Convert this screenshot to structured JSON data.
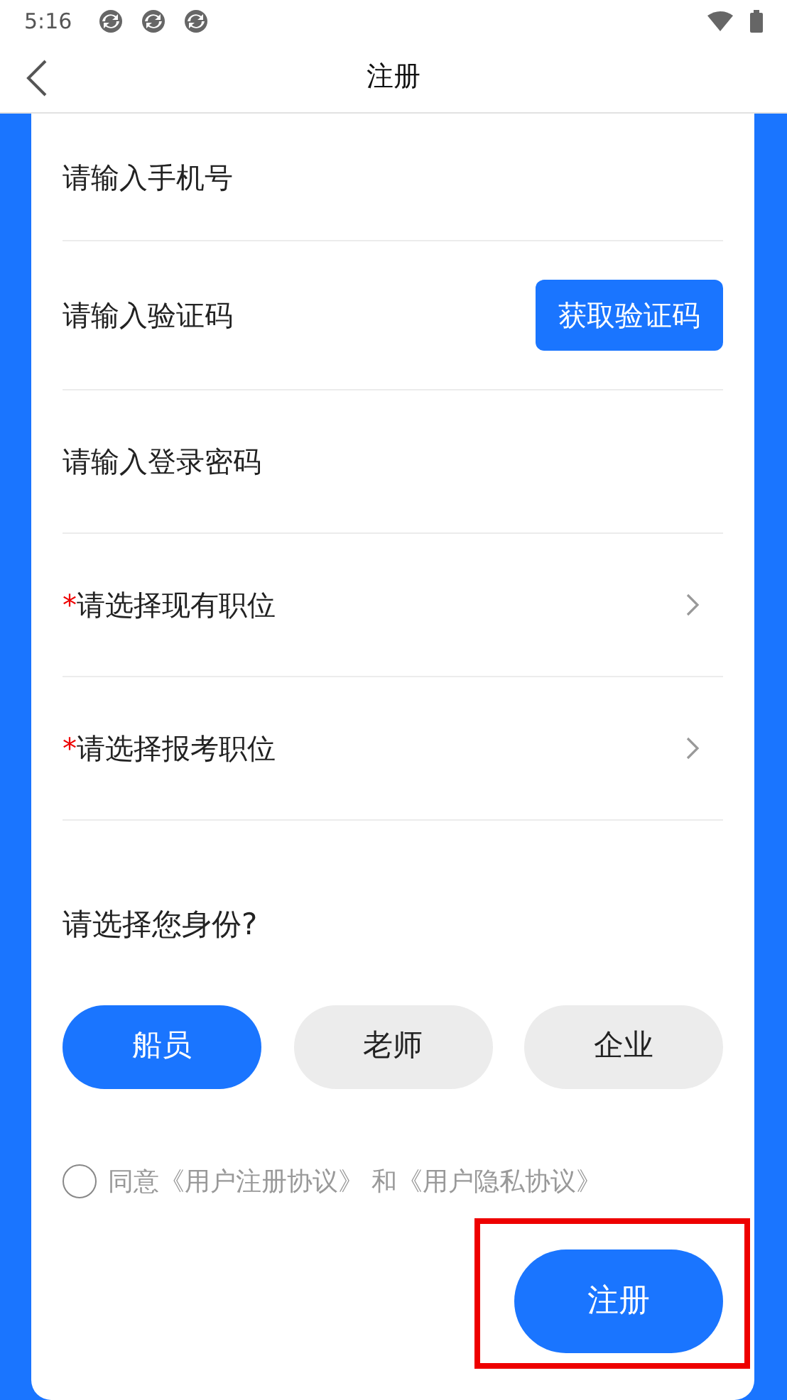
{
  "status_bar": {
    "time": "5:16"
  },
  "header": {
    "title": "注册"
  },
  "fields": [
    {
      "kind": "input",
      "placeholder": "请输入手机号"
    },
    {
      "kind": "code",
      "placeholder": "请输入验证码",
      "button": "获取验证码"
    },
    {
      "kind": "input",
      "placeholder": "请输入登录密码"
    },
    {
      "kind": "select",
      "marker": "*",
      "label": "请选择现有职位"
    },
    {
      "kind": "select",
      "marker": "*",
      "label": "请选择报考职位"
    }
  ],
  "identity": {
    "question": "请选择您身份?",
    "options": [
      {
        "label": "船员",
        "selected": true
      },
      {
        "label": "老师",
        "selected": false
      },
      {
        "label": "企业",
        "selected": false
      }
    ]
  },
  "agreement": {
    "checked": false,
    "text": "同意《用户注册协议》 和《用户隐私协议》"
  },
  "submit": {
    "label": "注册",
    "highlighted": true
  }
}
